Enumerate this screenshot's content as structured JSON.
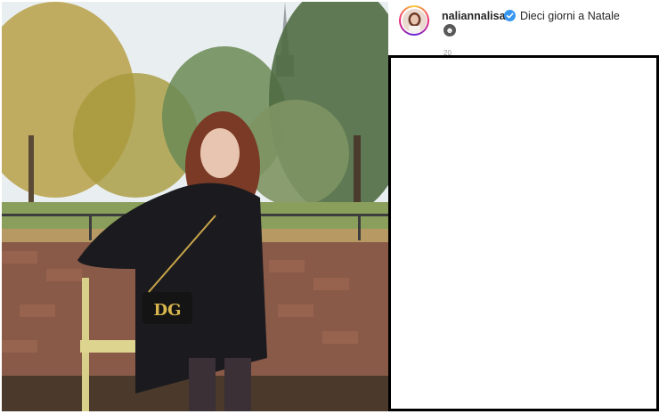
{
  "post": {
    "username": "naliannalisa",
    "caption": "Dieci giorni a Natale",
    "caption_emoji": "☻",
    "timestamp": "20",
    "image_alt": "photo",
    "bag_logo": "DG"
  },
  "colors": {
    "verified": "#3897f0",
    "text": "#262626",
    "overlay_border": "#000000"
  }
}
